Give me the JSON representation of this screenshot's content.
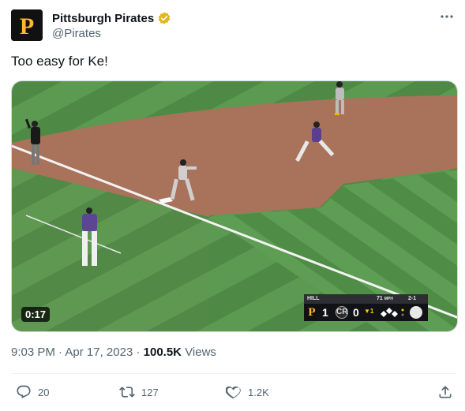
{
  "author": {
    "display_name": "Pittsburgh Pirates",
    "handle": "@Pirates",
    "avatar_letter": "P",
    "verified_badge": "gold-check-icon"
  },
  "more_icon": "more-horizontal-icon",
  "tweet": {
    "text": "Too easy for Ke!"
  },
  "media": {
    "type": "video",
    "duration": "0:17",
    "scorebug": {
      "pitcher": "HILL",
      "pitch_speed": "71",
      "pitch_speed_unit": "MPH",
      "count": "2-1",
      "away_logo": "P",
      "away_score": "1",
      "home_logo": "CR",
      "home_score": "0",
      "inning": "▼1"
    }
  },
  "meta": {
    "time": "9:03 PM",
    "separator": " · ",
    "date": "Apr 17, 2023",
    "views_count": "100.5K",
    "views_label": "Views"
  },
  "actions": {
    "reply": {
      "icon": "reply-icon",
      "count": "20"
    },
    "retweet": {
      "icon": "retweet-icon",
      "count": "127"
    },
    "like": {
      "icon": "heart-icon",
      "count": "1.2K"
    },
    "share": {
      "icon": "share-icon"
    }
  },
  "colors": {
    "text_primary": "#0f1419",
    "text_secondary": "#536471",
    "verified_gold": "#e2b719",
    "pirates_gold": "#fdb827",
    "divider": "#eff3f4"
  }
}
